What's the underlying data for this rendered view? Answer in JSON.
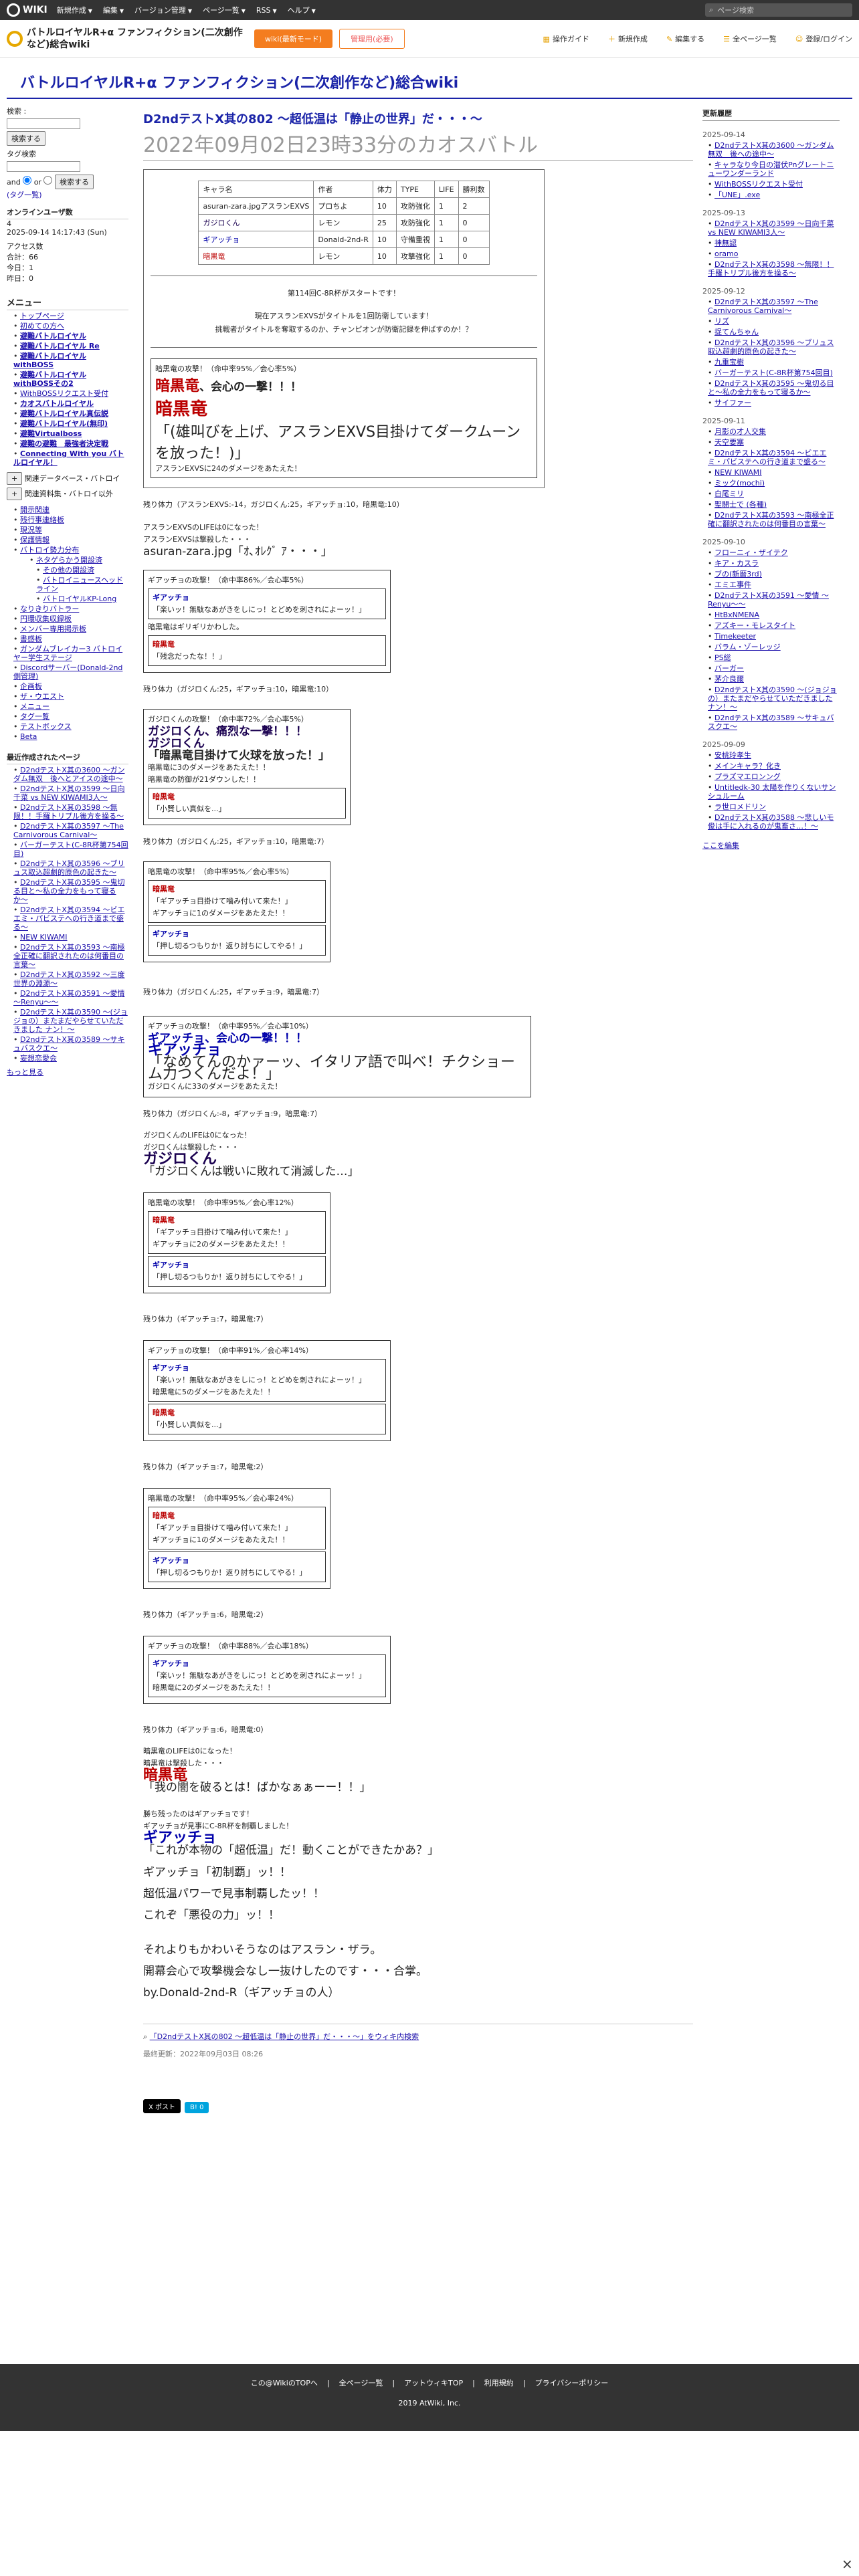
{
  "topbar": {
    "brand": "WIKI",
    "menus": [
      "新規作成",
      "編集",
      "バージョン管理",
      "ページ一覧",
      "RSS",
      "ヘルプ"
    ],
    "search_placeholder": "ページ検索"
  },
  "header": {
    "title": "バトルロイヤルR+α ファンフィクション(二次創作など)総合wiki",
    "btn_orange": "wiki(最新モード)",
    "btn_white": "管理用(必要)",
    "nav": [
      "操作ガイド",
      "新規作成",
      "編集する",
      "全ページ一覧",
      "登録/ログイン"
    ]
  },
  "site_title": "バトルロイヤルR+α ファンフィクション(二次創作など)総合wiki",
  "left": {
    "search_h": "検索 :",
    "search_btn": "検索する",
    "tag_label": "タグ検索",
    "and": "and",
    "or": "or",
    "tag_btn": "検索する",
    "tag_note": "(タグ一覧)",
    "online_h": "オンラインユーザ数",
    "online": "4",
    "date": "2025-09-14 14:17:43 (Sun)",
    "access_h": "アクセス数",
    "total": "合計：66",
    "today": "今日：1",
    "yesterday": "昨日：0",
    "menu_h": "メニュー",
    "menu": [
      "トップページ",
      "初めての方へ",
      "避難バトルロイヤル",
      "避難バトルロイヤル Re",
      "避難バトルロイヤル withBOSS",
      "避難バトルロイヤル withBOSSその2",
      "WithBOSSリクエスト受付",
      "カオスバトルロイヤル",
      "避難バトルロイヤル真伝説",
      "避難バトルロイヤル(無印)",
      "避難Virtualboss",
      "避難の避難　最強者決定戦",
      "Connecting With you バトルロイヤル！"
    ],
    "btns": [
      "関連データベース・バトロイ",
      "関連資料集・バトロイ以外"
    ],
    "menu2": [
      "開示関連",
      "残行事連絡板",
      "現況等",
      "保護情報",
      "バトロイ勢力分布",
      "ネタゲらかう開設済",
      "その他の開設済",
      "バトロイニュースヘッドライン",
      "バトロイヤルKP-Long",
      "なりきりバトラー",
      "円環収集収録板",
      "メンバー専用掲示板",
      "書感板",
      "ガンダムブレイカー3 バトロイヤー学生ステージ",
      "Discordサーバー(Donald-2nd側管理)"
    ],
    "other": [
      "企画板",
      "ザ・ウエスト",
      "メニュー",
      "タグ一覧",
      "テストボックス",
      "Beta"
    ],
    "recent_h": "最近作成されたページ",
    "recent": [
      "D2ndテストX其の3600 〜ガンダム無双　後へとアイスの途中〜",
      "D2ndテストX其の3599 〜日向千菜 vs NEW KIWAMI3人〜",
      "D2ndテストX其の3598 〜無限！！手羅トリプル後方を操る〜",
      "D2ndテストX其の3597 〜The Carnivorous Carnival〜",
      "バーガーテスト(C-8R杯第754回目)",
      "D2ndテストX其の3596 〜ブリュス取込超劇的原色の起きた〜",
      "D2ndテストX其の3595 〜鬼切る目と〜私の全力をもって寝るか〜",
      "D2ndテストX其の3594 〜ビエエミ・パビステへの行き道まで盛る〜",
      "NEW KIWAMI",
      "D2ndテストX其の3593 〜南極全正確に翻訳されたのは何番目の言葉〜",
      "D2ndテストX其の3592 〜三度世界の淵源〜",
      "D2ndテストX其の3591 〜愛情 〜Renyu〜〜",
      "D2ndテストX其の3590 〜(ジョジョの）またまだやらせていただきました ナン！〜",
      "D2ndテストX其の3589 〜サキュバスクエ〜",
      "妄想恋愛会"
    ],
    "more": "もっと見る"
  },
  "center": {
    "title": "D2ndテストX其の802 〜超低温は「静止の世界」だ・・・〜",
    "subtitle": "2022年09月02日23時33分のカオスバトル",
    "table_head": [
      "キャラ名",
      "作者",
      "体力",
      "TYPE",
      "LIFE",
      "勝利数"
    ],
    "table_rows": [
      [
        "asuran-zara.jpgアスランEXVS",
        "プロちよ",
        "10",
        "攻防強化",
        "1",
        "2"
      ],
      [
        "ガジロくん",
        "レモン",
        "25",
        "攻防強化",
        "1",
        "0"
      ],
      [
        "ギアッチョ",
        "Donald-2nd-R",
        "10",
        "守備重視",
        "1",
        "0"
      ],
      [
        "暗黒竜",
        "レモン",
        "10",
        "攻撃強化",
        "1",
        "0"
      ]
    ],
    "start": "第114回C-8R杯がスタートです！",
    "champ": "現在アスランEXVSがタイトルを1回防衛しています！",
    "challenge": "挑戦者がタイトルを奪取するのか、チャンピオンが防衛記録を伸ばすのか！？",
    "b1_attack": "暗黒竜の攻撃！（命中率95%／会心率5%）",
    "b1_name": "暗黒竜",
    "b1_crit": "、会心の一撃！！！",
    "b1_bigname": "暗黒竜",
    "b1_quote": "「(雄叫びを上げ、アスランEXVS目掛けてダークムーンを放った！)」",
    "b1_dmg": "アスランEXVSに24のダメージをあたえた！",
    "hp1": "残り体力（アスランEXVS:-14，ガジロくん:25，ギアッチョ:10，暗黒竜:10）",
    "life0": "アスランEXVSのLIFEは0になった！",
    "defeat1": "アスランEXVSは撃殺した・・・",
    "img_quote": "asuran-zara.jpg「ｵ､ｵﾚｸﾞ ｱ・・・」",
    "b2_lines": [
      "ギアッチョの攻撃！（命中率86%／会心率5%）",
      "ギアッチョ",
      "「楽いッ！無駄なあがきをしにっ！とどめを刺されによーッ！」",
      "暗黒竜はギリギリかわした。",
      "暗黒竜",
      "「残念だったな！！」"
    ],
    "hp2": "残り体力（ガジロくん:25，ギアッチョ:10，暗黒竜:10）",
    "b3_lines": [
      "ガジロくんの攻撃！（命中率72%／会心率5%）",
      "ガジロくん、痛烈な一撃！！！",
      "ガジロくん",
      "「暗黒竜目掛けて火球を放った！」",
      "暗黒竜に3のダメージをあたえた！！",
      "暗黒竜の防御が21ダウンした！！",
      "暗黒竜",
      "「小賢しい真似を...」"
    ],
    "hp3": "残り体力（ガジロくん:25，ギアッチョ:10，暗黒竜:7）",
    "b4_lines": [
      "暗黒竜の攻撃！（命中率95%／会心率5%）",
      "暗黒竜",
      "「ギアッチョ目掛けて噛み付いて来た！」",
      "ギアッチョに1のダメージをあたえた！！",
      "ギアッチョ",
      "「押し切るつもりか！返り討ちにしてやる！」"
    ],
    "hp4": "残り体力（ガジロくん:25，ギアッチョ:9，暗黒竜:7）",
    "b5_attack": "ギアッチョの攻撃！（命中率95%／会心率10%）",
    "b5_crit": "ギアッチョ、会心の一撃！！！",
    "b5_name": "ギアッチョ",
    "b5_quote": "「なめてんのかァーッ、イタリア語で叫べ！チクショーム力つくんだよ！」",
    "b5_dmg": "ガジロくんに33のダメージをあたえた！",
    "hp5": "残り体力（ガジロくん:-8，ギアッチョ:9，暗黒竜:7）",
    "life_g": "ガジロくんのLIFEは0になった！",
    "defeat_g": "ガジロくんは撃殺した・・・",
    "g_name": "ガジロくん",
    "g_quote": "「ガジロくんは戦いに敗れて消滅した…」",
    "b6_lines": [
      "暗黒竜の攻撃！（命中率95%／会心率12%）",
      "暗黒竜",
      "「ギアッチョ目掛けて噛み付いて来た！」",
      "ギアッチョに2のダメージをあたえた！！",
      "ギアッチョ",
      "「押し切るつもりか！返り討ちにしてやる！」"
    ],
    "hp6": "残り体力（ギアッチョ:7，暗黒竜:7）",
    "b7_lines": [
      "ギアッチョの攻撃！（命中率91%／会心率14%）",
      "ギアッチョ",
      "「楽いッ！無駄なあがきをしにっ！とどめを刺されによーッ！」",
      "暗黒竜に5のダメージをあたえた！！",
      "暗黒竜",
      "「小賢しい真似を...」"
    ],
    "hp7": "残り体力（ギアッチョ:7，暗黒竜:2）",
    "b8_lines": [
      "暗黒竜の攻撃！（命中率95%／会心率24%）",
      "暗黒竜",
      "「ギアッチョ目掛けて噛み付いて来た！」",
      "ギアッチョに1のダメージをあたえた！！",
      "ギアッチョ",
      "「押し切るつもりか！返り討ちにしてやる！」"
    ],
    "hp8": "残り体力（ギアッチョ:6，暗黒竜:2）",
    "b9_lines": [
      "ギアッチョの攻撃！（命中率88%／会心率18%）",
      "ギアッチョ",
      "「楽いッ！無駄なあがきをしにっ！とどめを刺されによーッ！」",
      "暗黒竜に2のダメージをあたえた！！"
    ],
    "hp9": "残り体力（ギアッチョ:6，暗黒竜:0）",
    "life_a": "暗黒竜のLIFEは0になった！",
    "defeat_a": "暗黒竜は撃殺した・・・",
    "a_name": "暗黒竜",
    "a_quote": "「我の闇を破るとは！ばかなぁぁーー！！」",
    "winner": "勝ち残ったのはギアッチョです！",
    "winner2": "ギアッチョが見事にC-8R杯を制覇しました！",
    "w_name": "ギアッチョ",
    "w_quote": "「これが本物の「超低温」だ！動くことができたかあ？」",
    "end_lines": [
      "ギアッチョ「初制覇」ッ！！",
      "超低温パワーで見事制覇したッ！！",
      "これぞ「悪役の力」ッ！！",
      "",
      "それよりもかわいそうなのはアスラン・ザラ。",
      "開幕会心で攻撃機会なし一抜けしたのです・・・合掌。",
      "by.Donald-2nd-R（ギアッチョの人）"
    ],
    "search_page": "「D2ndテストX其の802 〜超低温は「静止の世界」だ・・・〜」をウィキ内検索",
    "updated": "最終更新：2022年09月03日 08:26",
    "tweet": "X ポスト",
    "hatena": "B! 0"
  },
  "right": {
    "h": "更新履歴",
    "edit": "ここを編集",
    "groups": [
      {
        "date": "2025-09-14",
        "items": [
          "D2ndテストX其の3600 〜ガンダム無双　後への途中〜",
          "キャラなり今日の潜伏Pnグレートニューワンダーランド",
          "WithBOSSリクエスト受付",
          "「UNE」.exe"
        ]
      },
      {
        "date": "2025-09-13",
        "items": [
          "D2ndテストX其の3599 〜日向千菜 vs NEW KIWAMI3人〜",
          "神無認",
          "oramo",
          "D2ndテストX其の3598 〜無限！！手羅トリプル後方を操る〜"
        ]
      },
      {
        "date": "2025-09-12",
        "items": [
          "D2ndテストX其の3597 〜The Carnivorous Carnival〜",
          "リズ",
          "捉てんちゃん",
          "D2ndテストX其の3596 〜ブリュス取込超劇的原色の起きた〜",
          "九重宝樹",
          "バーガーテスト(C-8R杯第754回目)",
          "D2ndテストX其の3595 〜鬼切る目と〜私の全力をもって寝るか〜",
          "サイファー"
        ]
      },
      {
        "date": "2025-09-11",
        "items": [
          "月影の才人交集",
          "天空要塞",
          "D2ndテストX其の3594 〜ビエエミ・パビステへの行き道まで盛る〜",
          "NEW KIWAMI",
          "ミック(mochi)",
          "白尾ミリ",
          "聖闘士で (各種)",
          "D2ndテストX其の3593 〜南極全正確に翻訳されたのは何番目の言葉〜"
        ]
      },
      {
        "date": "2025-09-10",
        "items": [
          "フローニィ・ザイテク",
          "キア・カスラ",
          "ブの(新暦3rd)",
          "エミエ事件",
          "D2ndテストX其の3591 〜愛情 〜Renyu〜〜",
          "HtBxNMENA",
          "アズキー・モレスタイト",
          "Timekeeter",
          "バラム・ゾーレッジ",
          "PS総",
          "バーガー",
          "茅介良爾",
          "D2ndテストX其の3590 〜(ジョジョの）またまだやらせていただきました ナン！〜",
          "D2ndテストX其の3589 〜サキュバスクエ〜"
        ]
      },
      {
        "date": "2025-09-09",
        "items": [
          "安桃玲孝生",
          "メインキャラ？化き",
          "プラズマエロンング",
          "Untitledk-30 太陽を作りくないサンシュルーム",
          "ラ世ロメドリン",
          "D2ndテストX其の3588 〜悲しいモ俊は手に入れるのが鬼畜さ…！〜"
        ]
      }
    ]
  },
  "footer": {
    "links": [
      "この@WikiのTOPへ",
      "全ページ一覧",
      "アットウィキTOP",
      "利用規約",
      "プライバシーポリシー"
    ],
    "copy": "2019 AtWiki, Inc."
  }
}
